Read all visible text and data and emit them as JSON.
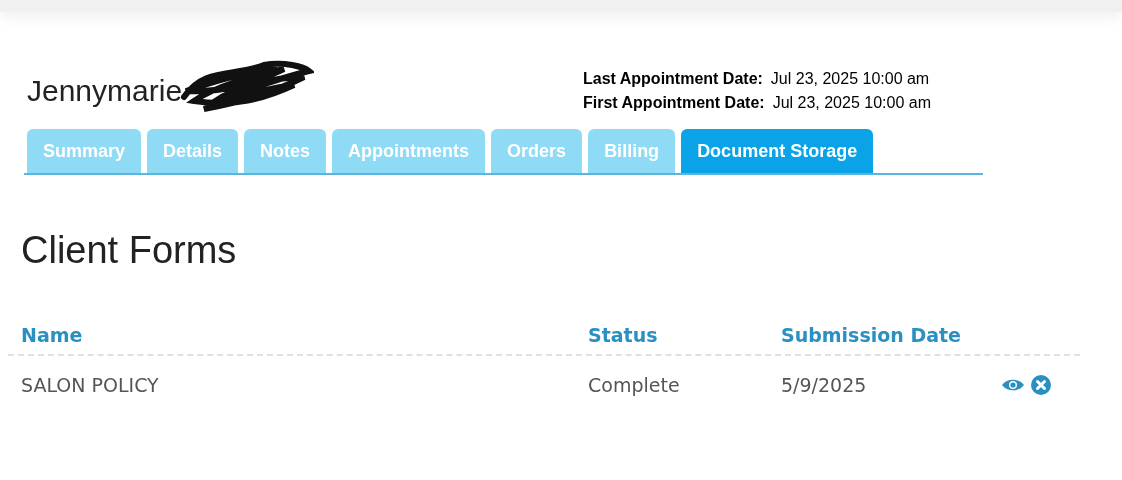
{
  "client": {
    "name": "Jennymarie"
  },
  "dates": [
    {
      "label": "Last Appointment Date:",
      "value": "Jul 23, 2025 10:00 am"
    },
    {
      "label": "First Appointment Date:",
      "value": "Jul 23, 2025 10:00 am"
    }
  ],
  "tabs": [
    {
      "label": "Summary",
      "selected": false
    },
    {
      "label": "Details",
      "selected": false
    },
    {
      "label": "Notes",
      "selected": false
    },
    {
      "label": "Appointments",
      "selected": false
    },
    {
      "label": "Orders",
      "selected": false
    },
    {
      "label": "Billing",
      "selected": false
    },
    {
      "label": "Document Storage",
      "selected": true
    }
  ],
  "section_title": "Client Forms",
  "table": {
    "columns": [
      "Name",
      "Status",
      "Submission Date"
    ],
    "rows": [
      {
        "name": "SALON POLICY",
        "status": "Complete",
        "date": "5/9/2025"
      }
    ]
  }
}
